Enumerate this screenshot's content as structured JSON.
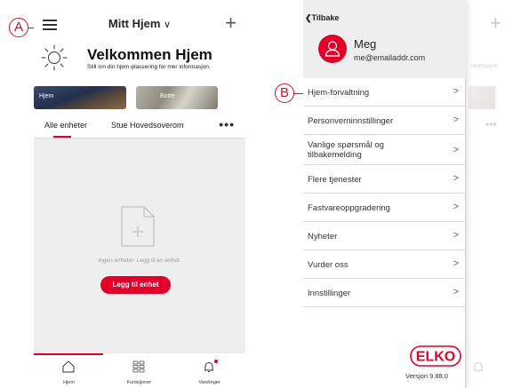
{
  "callouts": {
    "a": "A",
    "b": "B"
  },
  "left_phone": {
    "header": {
      "home_name": "Mitt Hjem",
      "chevron": "∨",
      "add_icon": "+"
    },
    "welcome": {
      "title": "Velkommen Hjem",
      "subtitle": "Still inn din hjem-plassering for mer informasjon."
    },
    "place_cards": [
      {
        "label": "Hjem"
      },
      {
        "label": "Borte"
      }
    ],
    "tabs": [
      {
        "label": "Alle enheter",
        "active": true
      },
      {
        "label": "Stue Hovedsoverom",
        "active": false
      }
    ],
    "more_icon": "•••",
    "empty_state": {
      "text": "Ingen enheter. Legg til en enhet.",
      "button": "Legg til enhet"
    },
    "bottom_nav": [
      {
        "label": "Hjem",
        "icon": "home-icon",
        "active": true
      },
      {
        "label": "Funksjoner",
        "icon": "grid-icon",
        "active": false
      },
      {
        "label": "Varslinger",
        "icon": "bell-icon",
        "active": false
      }
    ]
  },
  "right_phone": {
    "back_label": "Tilbake",
    "user": {
      "name": "Meg",
      "email": "me@emailaddr.com"
    },
    "menu_items": [
      {
        "label": "Hjem-forvaltning"
      },
      {
        "label": "Personverninnstillinger"
      },
      {
        "label": "Vanlige spørsmål og tilbakemelding"
      },
      {
        "label": "Flere tjenester"
      },
      {
        "label": "Fastvareoppgradering"
      },
      {
        "label": "Nyheter"
      },
      {
        "label": "Vurder oss"
      },
      {
        "label": "Innstillinger"
      }
    ],
    "chevron": ">",
    "logo_text": "ELKO",
    "version": "Versjon 9.88.0",
    "background": {
      "add_icon": "+",
      "text_fragment": "informasjon",
      "dots": "•••"
    }
  },
  "colors": {
    "accent": "#e0002a",
    "callout": "#c8102e",
    "panel_bg": "#eeeeee"
  }
}
